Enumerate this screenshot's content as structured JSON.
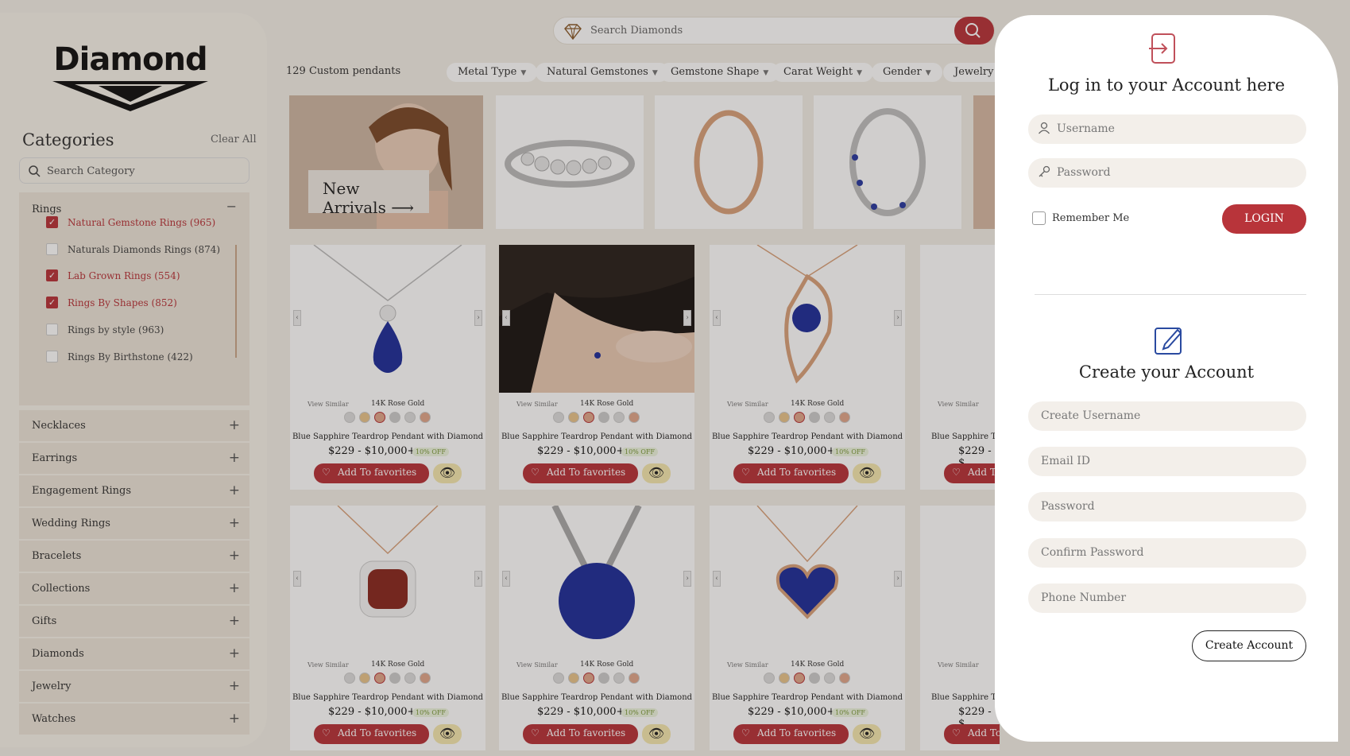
{
  "brand": {
    "logo_text": "Diamond"
  },
  "sidebar": {
    "title": "Categories",
    "clear_all": "Clear All",
    "search_placeholder": "Search Category",
    "rings": {
      "label": "Rings",
      "toggle": "−",
      "items": [
        {
          "label": "Natural Gemstone Rings (965)",
          "checked": true
        },
        {
          "label": "Naturals Diamonds Rings (874)",
          "checked": false
        },
        {
          "label": "Lab Grown Rings (554)",
          "checked": true
        },
        {
          "label": "Rings By Shapes (852)",
          "checked": true
        },
        {
          "label": "Rings by style (963)",
          "checked": false
        },
        {
          "label": "Rings By Birthstone (422)",
          "checked": false
        }
      ]
    },
    "categories": [
      "Necklaces",
      "Earrings",
      "Engagement Rings",
      "Wedding Rings",
      "Bracelets",
      "Collections",
      "Gifts",
      "Diamonds",
      "Jewelry",
      "Watches"
    ],
    "expand_symbol": "+"
  },
  "header": {
    "search_placeholder": "Search Diamonds",
    "result_count": "129 Custom pendants",
    "filters": [
      "Metal Type",
      "Natural Gemstones",
      "Gemstone Shape",
      "Carat Weight",
      "Gender",
      "Jewelry S"
    ]
  },
  "banner": {
    "label": "New Arrivals ⟶"
  },
  "product": {
    "view_similar": "View Similar",
    "metal": "14K Rose Gold",
    "name": "Blue Sapphire Teardrop Pendant with Diamond",
    "price": "$229 - $10,000+",
    "discount": "10% OFF",
    "fav_label": "Add To favorites",
    "partial_name": "Blue Sapphire Tea",
    "partial_price": "$229 - $",
    "partial_fav": "Add To fa"
  },
  "login_panel": {
    "title": "Log in to your Account here",
    "username_placeholder": "Username",
    "password_placeholder": "Password",
    "remember_label": "Remember Me",
    "login_button": "LOGIN"
  },
  "register_panel": {
    "title": "Create your Account",
    "fields": [
      "Create Username",
      "Email ID",
      "Password",
      "Confirm Password",
      "Phone Number"
    ],
    "create_button": "Create Account"
  },
  "colors": {
    "accent": "#b8343a",
    "sidebar_bg": "#f6f2ea",
    "page_bg": "#f3efe7"
  }
}
